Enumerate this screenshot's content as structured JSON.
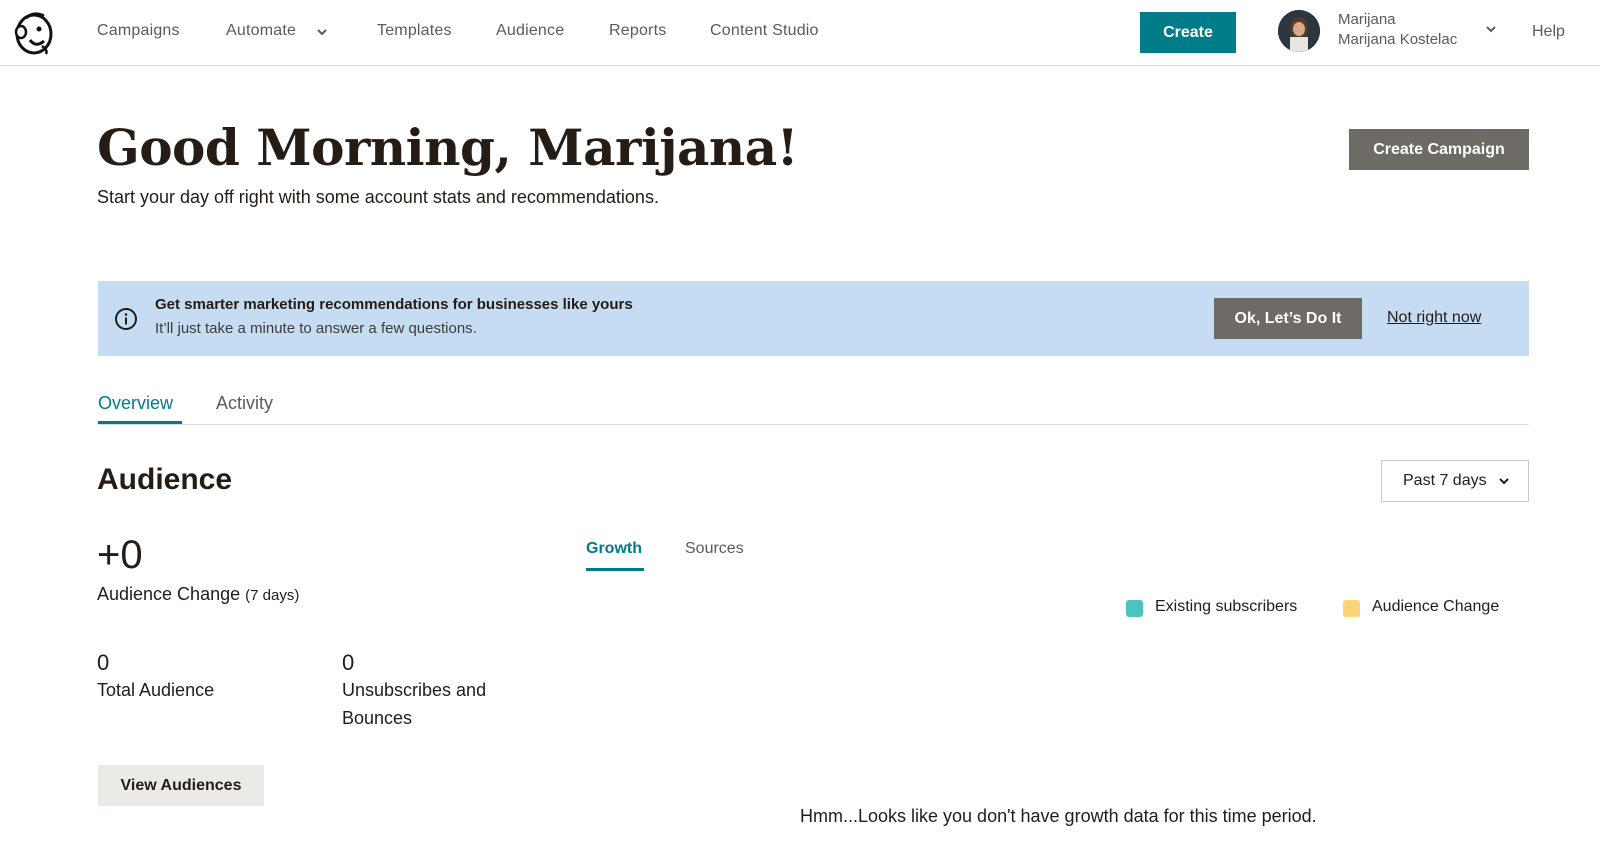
{
  "nav": {
    "items": [
      "Campaigns",
      "Automate",
      "Templates",
      "Audience",
      "Reports",
      "Content Studio"
    ],
    "create_label": "Create",
    "user_name": "Marijana",
    "user_org": "Marijana Kostelac",
    "help_label": "Help"
  },
  "header": {
    "greeting": "Good Morning, Marijana!",
    "subtitle": "Start your day off right with some account stats and recommendations.",
    "create_campaign_label": "Create Campaign"
  },
  "banner": {
    "title": "Get smarter marketing recommendations for businesses like yours",
    "text": "It’ll just take a minute to answer a few questions.",
    "ok_label": "Ok, Let’s Do It",
    "dismiss_label": "Not right now",
    "background": "#c6dcf2"
  },
  "tabs": [
    "Overview",
    "Activity"
  ],
  "audience": {
    "title": "Audience",
    "range": "Past 7 days",
    "change_value": "+0",
    "change_label": "Audience Change",
    "change_period": "(7 days)",
    "total_value": "0",
    "total_label": "Total Audience",
    "unsub_value": "0",
    "unsub_label": "Unsubscribes and Bounces",
    "view_label": "View Audiences",
    "subtabs": [
      "Growth",
      "Sources"
    ],
    "legend": [
      {
        "label": "Existing subscribers",
        "color": "#4cc3c1"
      },
      {
        "label": "Audience Change",
        "color": "#fbd57a"
      }
    ],
    "empty_message": "Hmm...Looks like you don't have growth data for this time period."
  },
  "colors": {
    "accent": "#007c89",
    "dark_button": "#6e6a66",
    "text": "#241c15"
  }
}
